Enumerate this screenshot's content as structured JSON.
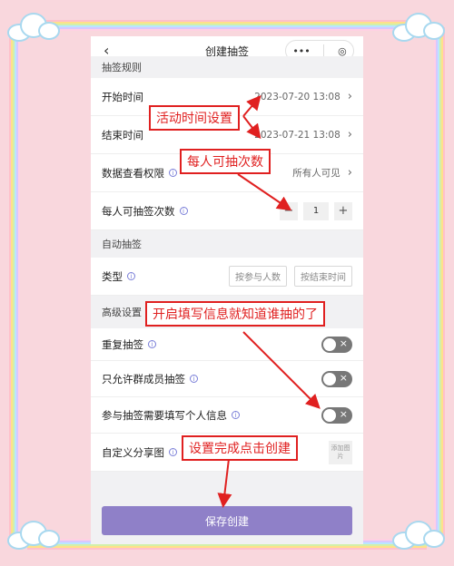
{
  "navbar": {
    "title": "创建抽签",
    "back": "‹",
    "more": "•••",
    "record": "◎"
  },
  "rows": {
    "section_rules": "抽签规则",
    "start_label": "开始时间",
    "start_value": "2023-07-20 13:08",
    "end_label": "结束时间",
    "end_value": "2023-07-21 13:08",
    "visibility_label": "数据查看权限",
    "visibility_value": "所有人可见",
    "draw_count_label": "每人可抽签次数",
    "draw_count_value": "1",
    "section_auto": "自动抽签",
    "type_label": "类型",
    "type_option1": "按参与人数",
    "type_option2": "按结束时间",
    "section_advanced": "高级设置",
    "repeat_label": "重复抽签",
    "members_only_label": "只允许群成员抽签",
    "info_required_label": "参与抽签需要填写个人信息",
    "share_image_label": "自定义分享图",
    "add_image": "添加图片"
  },
  "save_button": "保存创建",
  "annotations": {
    "time": "活动时间设置",
    "count": "每人可抽次数",
    "info": "开启填写信息就知道谁抽的了",
    "create": "设置完成点击创建"
  },
  "colors": {
    "accent": "#8f80c8",
    "annotation": "#e02020",
    "background": "#f9d7dd"
  }
}
